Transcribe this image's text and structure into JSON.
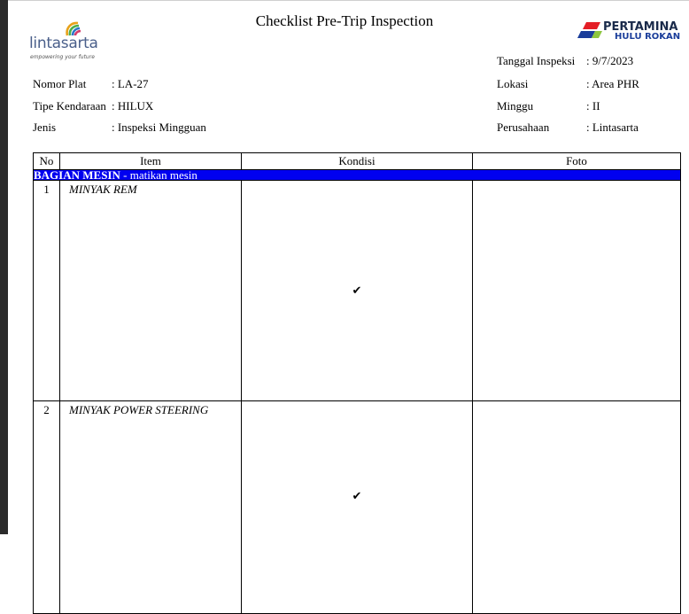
{
  "title": "Checklist Pre-Trip Inspection",
  "logo_left": {
    "name": "lintasarta",
    "tagline": "empowering your future"
  },
  "logo_right": {
    "line1": "PERTAMINA",
    "line2": "HULU ROKAN"
  },
  "fields_left": [
    {
      "label": "Nomor Plat",
      "value": ": LA-27"
    },
    {
      "label": "Tipe Kendaraan",
      "value": ": HILUX"
    },
    {
      "label": "Jenis",
      "value": ": Inspeksi Mingguan"
    }
  ],
  "fields_right": [
    {
      "label": "Tanggal Inspeksi",
      "value": ": 9/7/2023"
    },
    {
      "label": "Lokasi",
      "value": ": Area PHR"
    },
    {
      "label": "Minggu",
      "value": ": II"
    },
    {
      "label": "Perusahaan",
      "value": ": Lintasarta"
    }
  ],
  "table": {
    "headers": [
      "No",
      "Item",
      "Kondisi",
      "Foto"
    ],
    "section": {
      "name": "BAGIAN MESIN",
      "note": " - matikan mesin"
    },
    "rows": [
      {
        "no": "1",
        "item": "MINYAK REM",
        "kondisi": "✔",
        "foto": ""
      },
      {
        "no": "2",
        "item": "MINYAK POWER STEERING",
        "kondisi": "✔",
        "foto": ""
      }
    ]
  },
  "colors": {
    "section_bg": "#0000f0",
    "pertamina_red": "#e41e26",
    "pertamina_blue": "#1a3d9a",
    "pertamina_green": "#8dc63f"
  }
}
